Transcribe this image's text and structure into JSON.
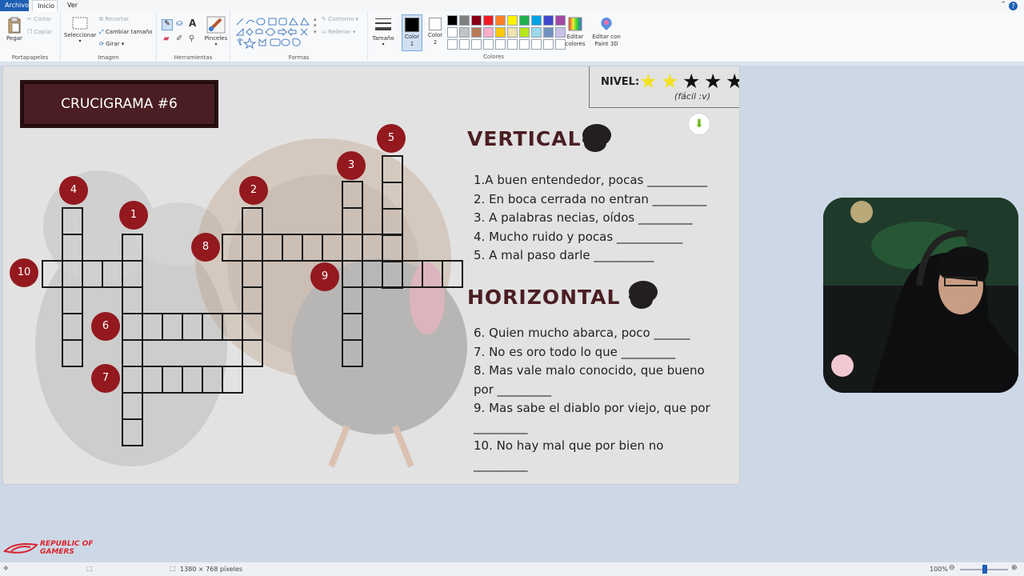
{
  "menubar": {
    "tabs": [
      "Archivo",
      "Inicio",
      "Ver"
    ]
  },
  "ribbon": {
    "portapapeles": {
      "label": "Portapapeles",
      "pegar": "Pegar",
      "cortar": "Cortar",
      "copiar": "Copiar"
    },
    "imagen": {
      "label": "Imagen",
      "seleccionar": "Seleccionar",
      "recortar": "Recortar",
      "cambiar": "Cambiar tamaño",
      "girar": "Girar"
    },
    "herramientas": {
      "label": "Herramientas",
      "pinceles": "Pinceles"
    },
    "formas": {
      "label": "Formas",
      "contorno": "Contorno",
      "rellenar": "Rellenar"
    },
    "tamano": "Tamaño",
    "color1": "Color 1",
    "color2": "Color 2",
    "colores": {
      "label": "Colores",
      "editar": "Editar colores",
      "paint3d": "Editar con Paint 3D"
    },
    "palette": [
      "#000000",
      "#7f7f7f",
      "#880015",
      "#ed1c24",
      "#ff7f27",
      "#fff200",
      "#22b14c",
      "#00a2e8",
      "#3f48cc",
      "#a349a4",
      "#ffffff",
      "#c3c3c3",
      "#b97a57",
      "#ffaec9",
      "#ffc90e",
      "#efe4b0",
      "#b5e61d",
      "#99d9ea",
      "#7092be",
      "#c8bfe7"
    ]
  },
  "crossword": {
    "title": "CRUCIGRAMA #6",
    "nivel": {
      "label": "NIVEL:",
      "sub": "(fácil :v)",
      "rating": 2,
      "max": 5
    },
    "numbers": [
      "1",
      "2",
      "3",
      "4",
      "5",
      "6",
      "7",
      "8",
      "9",
      "10"
    ],
    "vertical": {
      "heading": "VERTICAL",
      "clues": [
        "1.A buen entendedor, pocas __________",
        "2.  En boca cerrada no entran _________",
        "3.  A palabras necias, oídos _________",
        "4.  Mucho ruido y pocas ___________",
        "5.  A mal paso darle __________"
      ]
    },
    "horizontal": {
      "heading": "HORIZONTAL",
      "clues": [
        "6.  Quien mucho abarca, poco ______",
        "7. No es oro todo lo que _________",
        "8. Mas vale malo conocido, que bueno",
        "por  _________",
        "9. Mas sabe el diablo por viejo, que por",
        "_________",
        "10. No hay mal que por bien no",
        "_________"
      ]
    }
  },
  "statusbar": {
    "dimensions": "1380 × 768 píxeles",
    "zoom": "100%"
  },
  "overlay": {
    "brand": "REPUBLIC OF GAMERS"
  },
  "colors": {
    "accent": "#1e5fb4",
    "maroon": "#93191f",
    "title_bg": "#4a1e22",
    "star": "#f2e21e"
  }
}
